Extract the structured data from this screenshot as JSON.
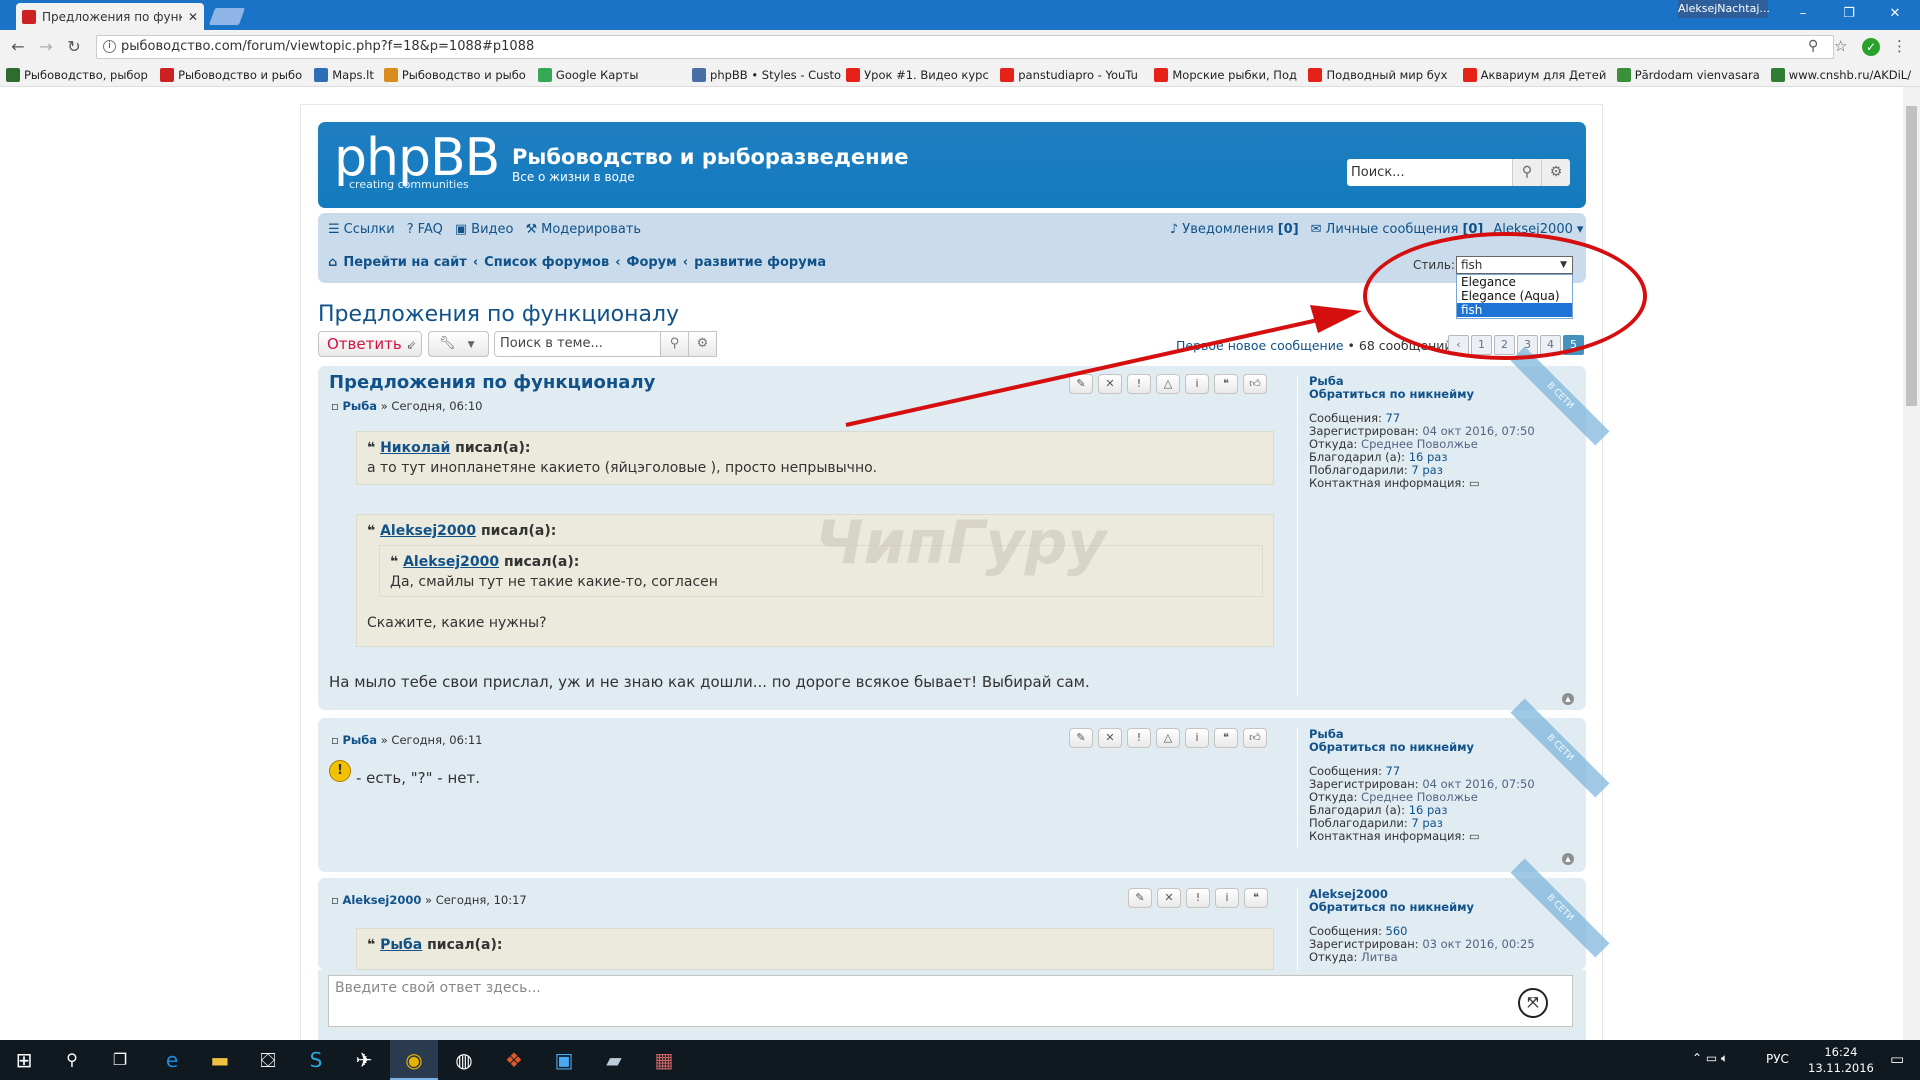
{
  "browser": {
    "tab_title": "Предложения по функц...",
    "profile_name": "AleksejNachtaj...",
    "url": "рыбоводство.com/forum/viewtopic.php?f=18&p=1088#p1088",
    "window_controls": [
      "–",
      "❐",
      "✕"
    ]
  },
  "bookmarks": [
    {
      "label": "Рыбоводство, рыбор",
      "color": "#2f6b2f"
    },
    {
      "label": "Рыбоводство и рыбо",
      "color": "#c22"
    },
    {
      "label": "Maps.lt",
      "color": "#2d6fb6"
    },
    {
      "label": "Рыбоводство и рыбо",
      "color": "#d98c1c"
    },
    {
      "label": "Google Карты",
      "color": "#34a853"
    },
    {
      "label": "phpBB • Styles - Custo",
      "color": "#4a6fa5"
    },
    {
      "label": "Урок #1. Видео курс",
      "color": "#e62117"
    },
    {
      "label": "panstudiapro - YouTu",
      "color": "#e62117"
    },
    {
      "label": "Морские рыбки, Под",
      "color": "#e62117"
    },
    {
      "label": "Подводный мир бух",
      "color": "#e62117"
    },
    {
      "label": "Аквариум для Детей",
      "color": "#e62117"
    },
    {
      "label": "Pārdodam vienvasara",
      "color": "#3a8f3a"
    },
    {
      "label": "www.cnshb.ru/AKDiL/",
      "color": "#2e7d32"
    }
  ],
  "forum": {
    "logo": "phpBB",
    "logo_sub": "creating   communities",
    "site_title": "Рыбоводство и рыборазведение",
    "site_desc": "Все о жизни в воде",
    "search_placeholder": "Поиск...",
    "nav_links": [
      "Ссылки",
      "FAQ",
      "Видео",
      "Модерировать"
    ],
    "notifications_label": "Уведомления",
    "notifications_count": "[0]",
    "pm_label": "Личные сообщения",
    "pm_count": "[0]",
    "username": "Aleksej2000",
    "breadcrumbs": [
      "Перейти на сайт",
      "Список форумов",
      "Форум",
      "развитие форума"
    ],
    "style_label": "Стиль:",
    "style_selected": "fish",
    "style_options": [
      "Elegance",
      "Elegance (Aqua)",
      "fish"
    ],
    "topic_title": "Предложения по функционалу",
    "reply_button": "Ответить",
    "topic_search_placeholder": "Поиск в теме...",
    "pagination_first_new": "Первое новое сообщение",
    "pagination_count": "• 68 сообщений",
    "pages": [
      "1",
      "2",
      "3",
      "4",
      "5"
    ],
    "current_page": "5"
  },
  "posts": [
    {
      "title": "Предложения по функционалу",
      "author": "Рыба",
      "time": "» Сегодня, 06:10",
      "quote1_author": "Николай",
      "quote1_text": "а то тут инопланетяне какието (яйцэголовые ), просто непрывычно.",
      "quote2_author": "Aleksej2000",
      "quote2_inner_author": "Aleksej2000",
      "quote2_inner_text": "Да, смайлы тут не такие какие-то, согласен",
      "quote2_text": "Скажите, какие нужны?",
      "text": "На мыло тебе свои прислал, уж и не знаю как дошли... по дороге всякое бывает! Выбирай сам.",
      "profile": {
        "name": "Рыба",
        "mention": "Обратиться по никнейму",
        "messages": "77",
        "registered": "04 окт 2016, 07:50",
        "from": "Среднее Поволжье",
        "thanked": "16 раз",
        "thanks_received": "7 раз"
      }
    },
    {
      "author": "Рыба",
      "time": "» Сегодня, 06:11",
      "text": "- есть, \"?\" - нет.",
      "profile": {
        "name": "Рыба",
        "mention": "Обратиться по никнейму",
        "messages": "77",
        "registered": "04 окт 2016, 07:50",
        "from": "Среднее Поволжье",
        "thanked": "16 раз",
        "thanks_received": "7 раз"
      }
    },
    {
      "author": "Aleksej2000",
      "time": "» Сегодня, 10:17",
      "quote1_author": "Рыба",
      "profile": {
        "name": "Aleksej2000",
        "mention": "Обратиться по никнейму",
        "messages": "560",
        "registered": "03 окт 2016, 00:25",
        "from": "Литва"
      }
    }
  ],
  "profile_labels": {
    "messages": "Сообщения:",
    "registered": "Зарегистрирован:",
    "from": "Откуда:",
    "thanked": "Благодарил (а):",
    "thanks_received": "Поблагодарили:",
    "contact": "Контактная информация:",
    "online": "В СЕТИ",
    "wrote": "писал(а):"
  },
  "watermark": "ЧипГуру",
  "reply_placeholder": "Введите свой ответ здесь...",
  "taskbar": {
    "lang": "РУС",
    "time": "16:24",
    "date": "13.11.2016"
  },
  "colors": {
    "accent": "#105289",
    "header": "#137bbf",
    "annotation": "#d50f0f"
  }
}
